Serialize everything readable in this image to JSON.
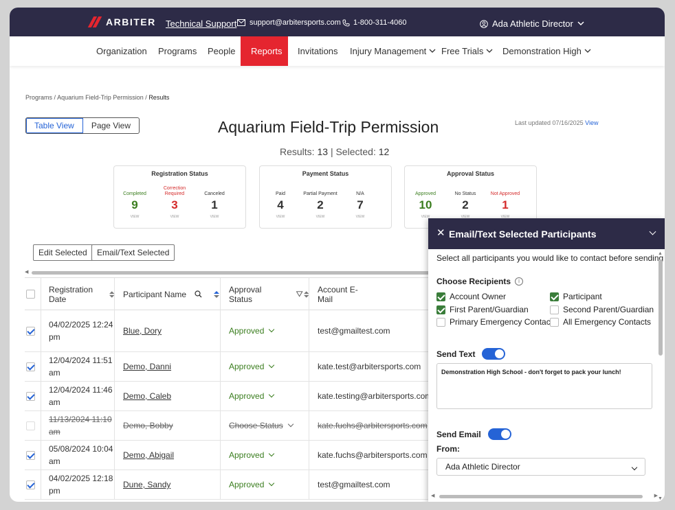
{
  "topbar": {
    "brand": "ARBITER",
    "support_link": "Technical Support",
    "email": "support@arbitersports.com",
    "phone": "1-800-311-4060",
    "user": "Ada Athletic Director"
  },
  "nav": {
    "items": [
      "Organization",
      "Programs",
      "People",
      "Reports",
      "Invitations",
      "Injury Management",
      "Free Trials",
      "Demonstration High"
    ],
    "active": "Reports"
  },
  "breadcrumb": {
    "programs": "Programs",
    "sep": "/",
    "program": "Aquarium Field-Trip Permission",
    "current": "Results"
  },
  "view_toggle": {
    "table": "Table View",
    "page": "Page View"
  },
  "page": {
    "title": "Aquarium Field-Trip Permission",
    "last_updated": "Last updated 07/16/2025",
    "view_link": "View",
    "results_label": "Results:",
    "results_count": "13",
    "selected_label": "Selected:",
    "selected_count": "12"
  },
  "cards": {
    "registration": {
      "title": "Registration Status",
      "stats": [
        {
          "label": "Completed",
          "value": "9",
          "view": "VIEW"
        },
        {
          "label": "Correction Required",
          "value": "3",
          "view": "VIEW"
        },
        {
          "label": "Canceled",
          "value": "1",
          "view": "VIEW"
        }
      ]
    },
    "payment": {
      "title": "Payment Status",
      "stats": [
        {
          "label": "Paid",
          "value": "4",
          "view": "VIEW"
        },
        {
          "label": "Partial Payment",
          "value": "2",
          "view": "VIEW"
        },
        {
          "label": "N/A",
          "value": "7",
          "view": "VIEW"
        }
      ]
    },
    "approval": {
      "title": "Approval Status",
      "stats": [
        {
          "label": "Approved",
          "value": "10",
          "view": "VIEW"
        },
        {
          "label": "No Status",
          "value": "2",
          "view": "VIEW"
        },
        {
          "label": "Not Approved",
          "value": "1",
          "view": "VIEW"
        }
      ]
    }
  },
  "actions": {
    "edit": "Edit Selected",
    "email_text": "Email/Text Selected"
  },
  "table": {
    "headers": {
      "date": "Registration Date",
      "name": "Participant Name",
      "approval": "Approval Status",
      "email": "Account E-Mail"
    },
    "rows": [
      {
        "date1": "04/02/2025 12:24",
        "date2": "pm",
        "name": "Blue, Dory",
        "status": "Approved",
        "email": "test@gmailtest.com"
      },
      {
        "date1": "12/04/2024 11:51",
        "date2": "am",
        "name": "Demo, Danni",
        "status": "Approved",
        "email": "kate.test@arbitersports.com"
      },
      {
        "date1": "12/04/2024 11:46",
        "date2": "am",
        "name": "Demo, Caleb",
        "status": "Approved",
        "email": "kate.testing@arbitersports.com"
      },
      {
        "date1": "11/13/2024 11:10",
        "date2": "am",
        "name": "Demo, Bobby",
        "status": "Choose Status",
        "email": "kate.fuchs@arbitersports.com"
      },
      {
        "date1": "05/08/2024 10:04",
        "date2": "am",
        "name": "Demo, Abigail",
        "status": "Approved",
        "email": "kate.fuchs@arbitersports.com"
      },
      {
        "date1": "04/02/2025 12:18",
        "date2": "pm",
        "name": "Dune, Sandy",
        "status": "Approved",
        "email": "test@gmailtest.com"
      }
    ]
  },
  "panel": {
    "title": "Email/Text Selected Participants",
    "intro": "Select all participants you would like to contact before sending",
    "choose_label": "Choose Recipients",
    "recipients": {
      "account_owner": "Account Owner",
      "participant": "Participant",
      "first_parent": "First Parent/Guardian",
      "second_parent": "Second Parent/Guardian",
      "primary_emergency": "Primary Emergency Contact",
      "all_emergency": "All Emergency Contacts"
    },
    "send_text_label": "Send Text",
    "message": "Demonstration High School - don't forget to pack your lunch!",
    "send_email_label": "Send Email",
    "from_label": "From:",
    "from_value": "Ada Athletic Director"
  },
  "colors": {
    "header_bg": "#2d2b47",
    "accent_red": "#e5252f",
    "link_blue": "#2563d6",
    "approved_green": "#3a7d1e",
    "alert_red": "#d42a2a"
  }
}
